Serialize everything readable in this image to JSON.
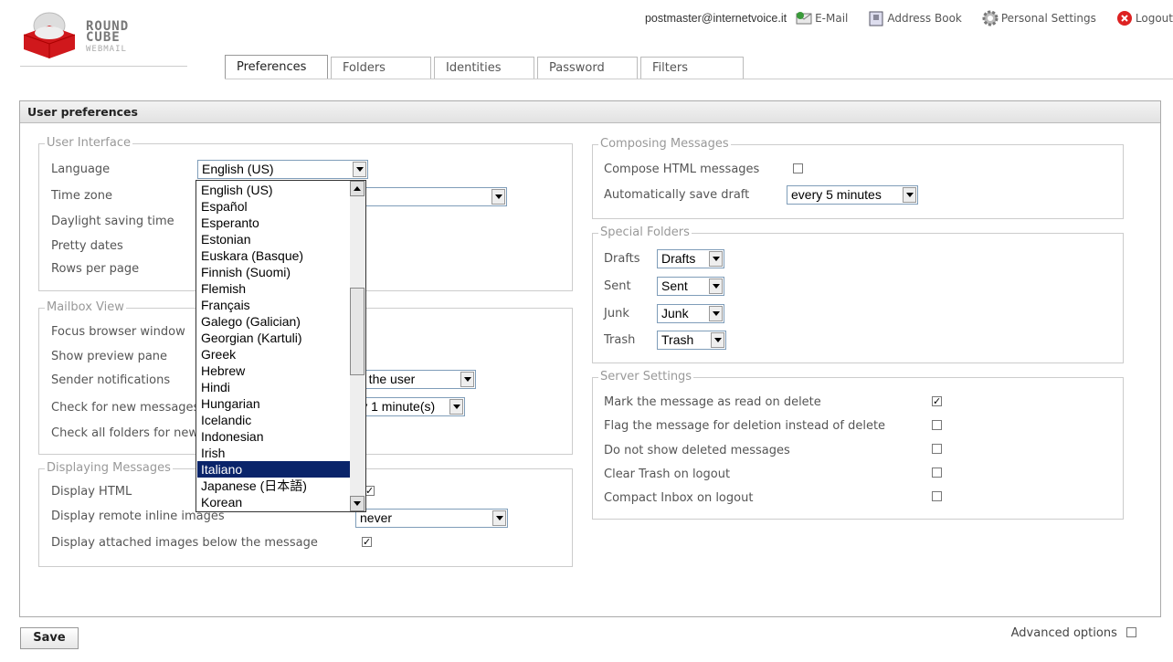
{
  "logo": {
    "line1": "ROUND",
    "line2": "CUBE",
    "line3": "WEBMAIL"
  },
  "topnav": {
    "user": "postmaster@internetvoice.it",
    "links": [
      {
        "label": "E-Mail",
        "icon": "mail-icon"
      },
      {
        "label": "Address Book",
        "icon": "address-book-icon"
      },
      {
        "label": "Personal Settings",
        "icon": "gear-icon"
      },
      {
        "label": "Logout",
        "icon": "logout-icon"
      }
    ]
  },
  "tabs": [
    "Preferences",
    "Folders",
    "Identities",
    "Password",
    "Filters"
  ],
  "box_title": "User preferences",
  "user_interface": {
    "legend": "User Interface",
    "language_label": "Language",
    "language_value": "English (US)",
    "timezone_label": "Time zone",
    "dst_label": "Daylight saving time",
    "pretty_dates_label": "Pretty dates",
    "rows_label": "Rows per page"
  },
  "mailbox_view": {
    "legend": "Mailbox View",
    "focus_label": "Focus browser window",
    "preview_label": "Show preview pane",
    "sender_label": "Sender notifications",
    "sender_value": "ask the user",
    "check_label": "Check for new messages",
    "check_value": "every 1 minute(s)",
    "check_all_label": "Check all folders for new messages"
  },
  "displaying": {
    "legend": "Displaying Messages",
    "html_label": "Display HTML",
    "remote_label": "Display remote inline images",
    "remote_value": "never",
    "attached_label": "Display attached images below the message"
  },
  "language_options": [
    "English (US)",
    "Español",
    "Esperanto",
    "Estonian",
    "Euskara (Basque)",
    "Finnish (Suomi)",
    "Flemish",
    "Français",
    "Galego (Galician)",
    "Georgian (Kartuli)",
    "Greek",
    "Hebrew",
    "Hindi",
    "Hungarian",
    "Icelandic",
    "Indonesian",
    "Irish",
    "Italiano",
    "Japanese (日本語)",
    "Korean"
  ],
  "language_highlighted": "Italiano",
  "composing": {
    "legend": "Composing Messages",
    "html_label": "Compose HTML messages",
    "draft_label": "Automatically save draft",
    "draft_value": "every 5 minutes"
  },
  "special_folders": {
    "legend": "Special Folders",
    "rows": [
      {
        "label": "Drafts",
        "value": "Drafts"
      },
      {
        "label": "Sent",
        "value": "Sent"
      },
      {
        "label": "Junk",
        "value": "Junk"
      },
      {
        "label": "Trash",
        "value": "Trash"
      }
    ]
  },
  "server": {
    "legend": "Server Settings",
    "rows": [
      {
        "label": "Mark the message as read on delete",
        "checked": true
      },
      {
        "label": "Flag the message for deletion instead of delete",
        "checked": false
      },
      {
        "label": "Do not show deleted messages",
        "checked": false
      },
      {
        "label": "Clear Trash on logout",
        "checked": false
      },
      {
        "label": "Compact Inbox on logout",
        "checked": false
      }
    ]
  },
  "footer": {
    "save": "Save",
    "advanced": "Advanced options"
  }
}
